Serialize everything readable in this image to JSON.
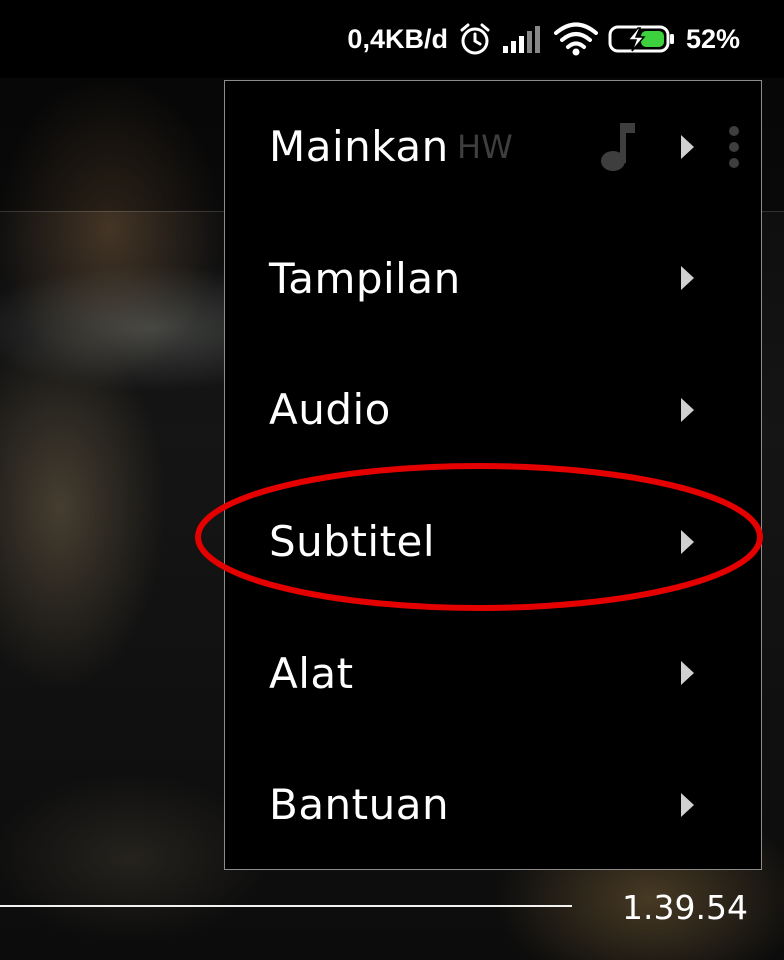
{
  "status_bar": {
    "net_speed": "0,4KB/d",
    "alarm_icon": "alarm-clock-icon",
    "signal_icon": "cellular-signal-icon",
    "wifi_icon": "wifi-icon",
    "battery_icon": "battery-charging-icon",
    "battery_percent": "52%",
    "battery_level": 0.52
  },
  "menu": {
    "items": [
      {
        "label": "Mainkan",
        "badge": "HW",
        "has_submenu": true
      },
      {
        "label": "Tampilan",
        "has_submenu": true
      },
      {
        "label": "Audio",
        "has_submenu": true
      },
      {
        "label": "Subtitel",
        "has_submenu": true,
        "highlighted": true
      },
      {
        "label": "Alat",
        "has_submenu": true
      },
      {
        "label": "Bantuan",
        "has_submenu": true
      }
    ],
    "extra_icons": [
      "music-note-icon",
      "more-vertical-icon"
    ],
    "arrow_icon": "chevron-right-icon"
  },
  "player": {
    "duration": "1.39.54"
  },
  "colors": {
    "highlight": "#e50000",
    "battery_fill": "#3dd13d",
    "hw_badge": "#3e3e3e"
  }
}
